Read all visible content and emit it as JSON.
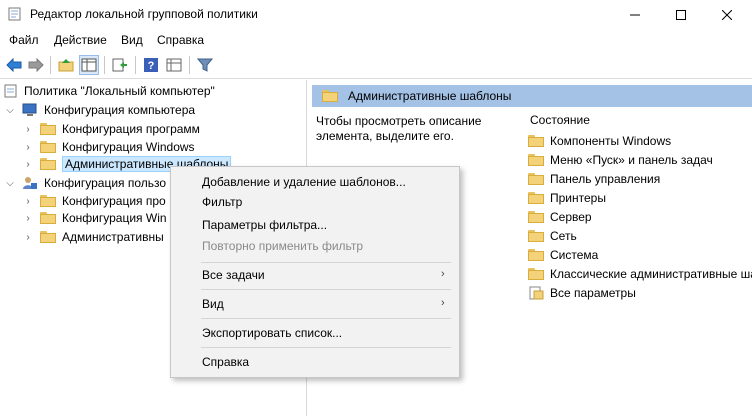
{
  "window": {
    "title": "Редактор локальной групповой политики"
  },
  "menu": [
    "Файл",
    "Действие",
    "Вид",
    "Справка"
  ],
  "tree": {
    "root": "Политика \"Локальный компьютер\"",
    "computer": "Конфигурация компьютера",
    "computer_children": [
      "Конфигурация программ",
      "Конфигурация Windows",
      "Административные шаблоны"
    ],
    "user": "Конфигурация пользо",
    "user_children": [
      "Конфигурация про",
      "Конфигурация Win",
      "Административны"
    ]
  },
  "right": {
    "header": "Административные шаблоны",
    "description": "Чтобы просмотреть описание элемента, выделите его.",
    "column": "Состояние",
    "items": [
      "Компоненты Windows",
      "Меню «Пуск» и панель задач",
      "Панель управления",
      "Принтеры",
      "Сервер",
      "Сеть",
      "Система",
      "Классические административные ша",
      "Все параметры"
    ]
  },
  "context_menu": {
    "add_remove": "Добавление и удаление шаблонов...",
    "filter": "Фильтр",
    "filter_params": "Параметры фильтра...",
    "reapply": "Повторно применить фильтр",
    "all_tasks": "Все задачи",
    "view": "Вид",
    "export": "Экспортировать список...",
    "help": "Справка"
  }
}
